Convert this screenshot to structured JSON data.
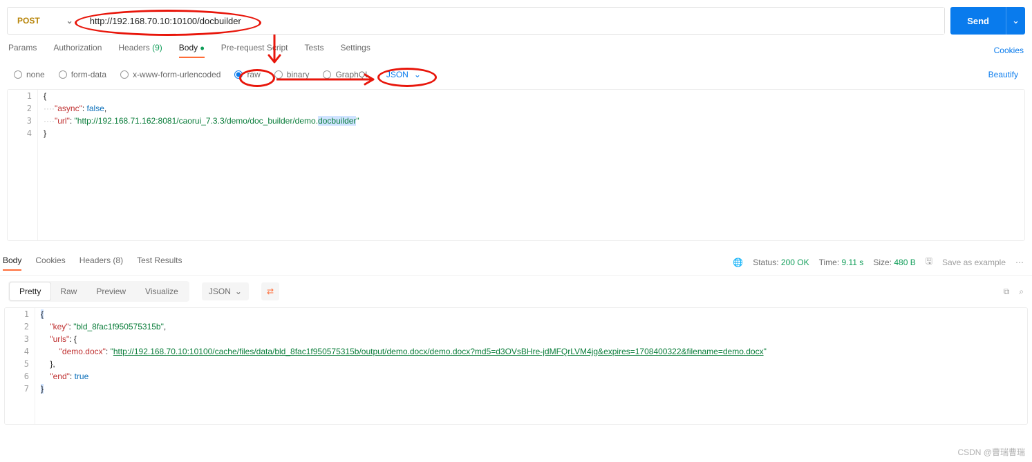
{
  "method": "POST",
  "url": "http://192.168.70.10:10100/docbuilder",
  "send_label": "Send",
  "tabs": {
    "params": "Params",
    "auth": "Authorization",
    "headers": "Headers",
    "headers_count": "(9)",
    "body": "Body",
    "prerequest": "Pre-request Script",
    "tests": "Tests",
    "settings": "Settings",
    "cookies": "Cookies"
  },
  "body_types": {
    "none": "none",
    "formdata": "form-data",
    "xwww": "x-www-form-urlencoded",
    "raw": "raw",
    "binary": "binary",
    "graphql": "GraphQL",
    "json_select": "JSON",
    "beautify": "Beautify"
  },
  "req_body": {
    "l1": "{",
    "l2_key": "\"async\"",
    "l2_val": "false",
    "l3_key": "\"url\"",
    "l3_val_pre": "\"http://192.168.71.162:8081/caorui_7.3.3/demo/doc_builder/demo.",
    "l3_val_sel": "docbuilder",
    "l3_val_post": "\"",
    "l4": "}"
  },
  "resp_tabs": {
    "body": "Body",
    "cookies": "Cookies",
    "headers": "Headers",
    "headers_count": "(8)",
    "test_results": "Test Results"
  },
  "resp_status": {
    "status_label": "Status:",
    "status_value": "200 OK",
    "time_label": "Time:",
    "time_value": "9.11 s",
    "size_label": "Size:",
    "size_value": "480 B",
    "save_as": "Save as example"
  },
  "resp_toolbar": {
    "pretty": "Pretty",
    "raw": "Raw",
    "preview": "Preview",
    "visualize": "Visualize",
    "json": "JSON"
  },
  "resp_body": {
    "l1": "{",
    "k_key": "\"key\"",
    "v_key": "\"bld_8fac1f950575315b\"",
    "k_urls": "\"urls\"",
    "k_demo": "\"demo.docx\"",
    "v_demo_url": "http://192.168.70.10:10100/cache/files/data/bld_8fac1f950575315b/output/demo.docx/demo.docx?md5=d3OVsBHre-jdMFQrLVM4jg&expires=1708400322&filename=demo.docx",
    "k_end": "\"end\"",
    "v_end": "true",
    "close_brace": "}",
    "close_inner": "},"
  },
  "watermark": "CSDN @曹瑞曹瑞"
}
